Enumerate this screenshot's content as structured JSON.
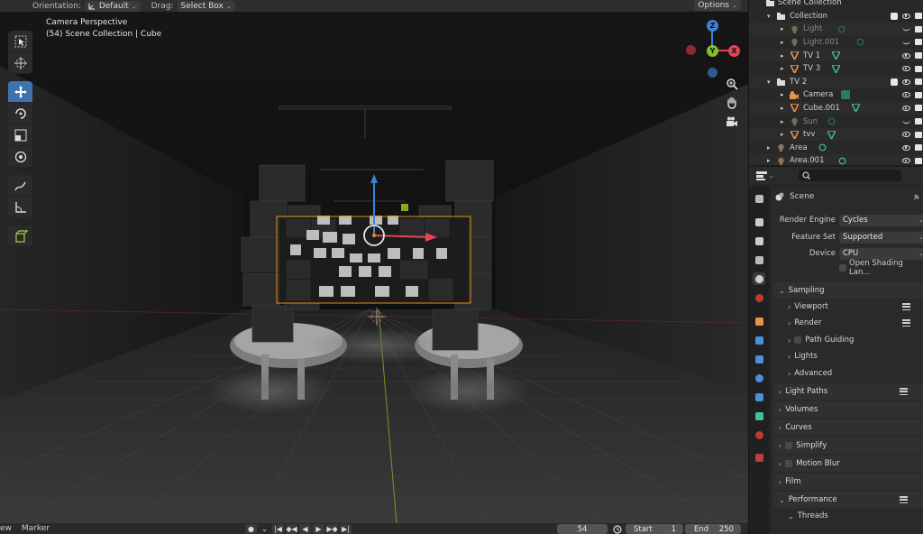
{
  "header": {
    "orientation_label": "Orientation:",
    "orientation_value": "Default",
    "drag_label": "Drag:",
    "drag_value": "Select Box",
    "options_label": "Options"
  },
  "viewport": {
    "view_name": "Camera Perspective",
    "view_info": "(54) Scene Collection | Cube",
    "gizmo": {
      "z": "Z",
      "y": "Y",
      "x": "X"
    }
  },
  "tools": [
    "select-box",
    "cursor",
    "move",
    "rotate",
    "scale",
    "transform",
    "annotate",
    "measure",
    "add-cube"
  ],
  "timeline": {
    "view_menu": "ew",
    "marker_menu": "Marker",
    "current_frame": "54",
    "start_label": "Start",
    "start_value": "1",
    "end_label": "End",
    "end_value": "250"
  },
  "outliner": {
    "root": "Scene Collection",
    "rows": [
      {
        "name": "Collection",
        "type": "collection",
        "dim": false
      },
      {
        "name": "Light",
        "type": "light",
        "dim": true
      },
      {
        "name": "Light.001",
        "type": "light",
        "dim": true
      },
      {
        "name": "TV 1",
        "type": "mesh",
        "dim": false
      },
      {
        "name": "TV 3",
        "type": "mesh",
        "dim": false
      },
      {
        "name": "TV 2",
        "type": "collection",
        "dim": false
      },
      {
        "name": "Camera",
        "type": "camera",
        "dim": false
      },
      {
        "name": "Cube.001",
        "type": "mesh",
        "dim": false
      },
      {
        "name": "Sun",
        "type": "light",
        "dim": true
      },
      {
        "name": "tvv",
        "type": "mesh",
        "dim": false
      },
      {
        "name": "Area",
        "type": "light",
        "dim": false
      },
      {
        "name": "Area.001",
        "type": "light",
        "dim": false
      }
    ]
  },
  "properties": {
    "context": "Scene",
    "render_engine_label": "Render Engine",
    "render_engine_value": "Cycles",
    "feature_set_label": "Feature Set",
    "feature_set_value": "Supported",
    "device_label": "Device",
    "device_value": "CPU",
    "osl_label": "Open Shading Lan...",
    "sampling": "Sampling",
    "viewport": "Viewport",
    "render": "Render",
    "path_guiding": "Path Guiding",
    "lights": "Lights",
    "advanced": "Advanced",
    "light_paths": "Light Paths",
    "volumes": "Volumes",
    "curves": "Curves",
    "simplify": "Simplify",
    "motion_blur": "Motion Blur",
    "film": "Film",
    "performance": "Performance",
    "threads": "Threads"
  },
  "colors": {
    "accent": "#3f73b0",
    "selection_orange": "#e58e1a",
    "axis_x": "#e34556",
    "axis_y": "#7fc12c",
    "axis_z": "#3c82d8",
    "mesh_icon": "#e8924a",
    "data_green": "#3fbf9a"
  }
}
